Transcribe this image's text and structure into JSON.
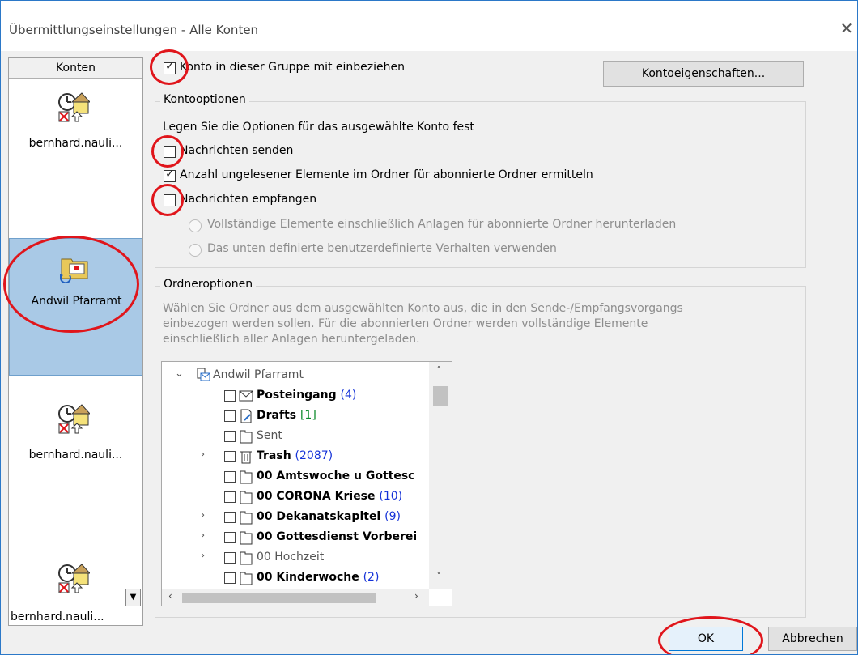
{
  "window": {
    "title": "Übermittlungseinstellungen - Alle Konten"
  },
  "accounts": {
    "header": "Konten",
    "items": [
      {
        "label": "bernhard.nauli...",
        "icon": "account-offline-icon"
      },
      {
        "label": "Andwil Pfarramt",
        "icon": "account-sync-icon",
        "selected": true
      },
      {
        "label": "bernhard.nauli...",
        "icon": "account-offline-icon"
      },
      {
        "label": "bernhard.nauli...",
        "icon": "account-offline-icon"
      }
    ]
  },
  "include_group": {
    "label": "Konto in dieser Gruppe mit einbeziehen",
    "checked": true
  },
  "properties_button": "Kontoeigenschaften...",
  "account_options": {
    "title": "Kontooptionen",
    "intro": "Legen Sie die Optionen für das ausgewählte Konto fest",
    "send": {
      "label": "Nachrichten senden",
      "checked": false
    },
    "unread": {
      "label": "Anzahl ungelesener Elemente im Ordner für abonnierte Ordner ermitteln",
      "checked": true
    },
    "receive": {
      "label": "Nachrichten empfangen",
      "checked": false
    },
    "radio_full": "Vollständige Elemente einschließlich Anlagen für abonnierte Ordner herunterladen",
    "radio_custom": "Das unten definierte benutzerdefinierte Verhalten verwenden"
  },
  "folder_options": {
    "title": "Ordneroptionen",
    "desc_line1": "Wählen Sie Ordner aus dem ausgewählten Konto aus, die in den Sende-/Empfangsvorgangs",
    "desc_line2": "einbezogen werden sollen. Für die abonnierten Ordner werden vollständige Elemente",
    "desc_line3": "einschließlich aller Anlagen heruntergeladen.",
    "root": "Andwil Pfarramt",
    "folders": [
      {
        "name": "Posteingang",
        "count": "(4)",
        "bold": true,
        "icon": "mail-icon",
        "expand": false,
        "count_color": "blue"
      },
      {
        "name": "Drafts",
        "count": "[1]",
        "bold": true,
        "icon": "drafts-icon",
        "expand": false,
        "count_color": "green"
      },
      {
        "name": "Sent",
        "count": "",
        "bold": false,
        "icon": "folder-icon",
        "expand": false
      },
      {
        "name": "Trash",
        "count": "(2087)",
        "bold": true,
        "icon": "trash-icon",
        "expand": true,
        "count_color": "blue"
      },
      {
        "name": "00 Amtswoche u Gottesc",
        "count": "",
        "bold": true,
        "icon": "folder-icon",
        "expand": false
      },
      {
        "name": "00 CORONA Kriese",
        "count": "(10)",
        "bold": true,
        "icon": "folder-icon",
        "expand": false,
        "count_color": "blue"
      },
      {
        "name": "00 Dekanatskapitel",
        "count": "(9)",
        "bold": true,
        "icon": "folder-icon",
        "expand": true,
        "count_color": "blue"
      },
      {
        "name": "00 Gottesdienst Vorberei",
        "count": "",
        "bold": true,
        "icon": "folder-icon",
        "expand": true
      },
      {
        "name": "00 Hochzeit",
        "count": "",
        "bold": false,
        "icon": "folder-icon",
        "expand": true
      },
      {
        "name": "00 Kinderwoche",
        "count": "(2)",
        "bold": true,
        "icon": "folder-icon",
        "expand": false,
        "count_color": "blue"
      }
    ]
  },
  "buttons": {
    "ok": "OK",
    "cancel": "Abbrechen"
  },
  "colors": {
    "annotation": "#e0151b",
    "selection": "#a9c9e6",
    "count_blue": "#1432d8"
  }
}
